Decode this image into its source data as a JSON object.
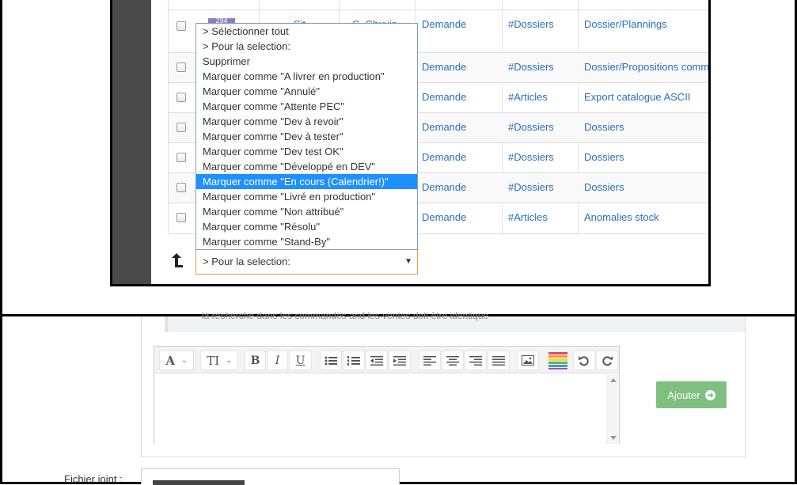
{
  "table": {
    "rows": [
      {
        "tag": "294",
        "col2": "...Sit...",
        "col3": "C. Chuvin",
        "type": "Demande",
        "category": "#Dossiers",
        "subject": "Dossier/Plannings"
      },
      {
        "type": "Demande",
        "category": "#Dossiers",
        "subject": "Dossier/Propositions comm"
      },
      {
        "type": "Demande",
        "category": "#Articles",
        "subject": "Export catalogue ASCII"
      },
      {
        "type": "Demande",
        "category": "#Dossiers",
        "subject": "Dossiers"
      },
      {
        "type": "Demande",
        "category": "#Dossiers",
        "subject": "Dossiers"
      },
      {
        "type": "Demande",
        "category": "#Dossiers",
        "subject": "Dossiers"
      },
      {
        "type": "Demande",
        "category": "#Articles",
        "subject": "Anomalies stock"
      }
    ]
  },
  "bulk_action": {
    "options": [
      "> Sélectionner tout",
      "> Pour la selection:",
      "Supprimer",
      "Marquer comme \"A livrer en production\"",
      "Marquer comme \"Annulé\"",
      "Marquer comme \"Attente PEC\"",
      "Marquer comme \"Dev à revoir\"",
      "Marquer comme \"Dev à tester\"",
      "Marquer comme \"Dev test OK\"",
      "Marquer comme \"Développé en DEV\"",
      "Marquer comme \"En cours (Calendrier!)\"",
      "Marquer comme \"Livré en production\"",
      "Marquer comme \"Non attribué\"",
      "Marquer comme \"Résolu\"",
      "Marquer comme \"Stand-By\""
    ],
    "highlighted_index": 10,
    "selected_value": "> Pour la selection:"
  },
  "comment": {
    "quote_text": "la recherche dans les commandes and les ventes doit être identique"
  },
  "editor": {
    "toolbar": {
      "font_label": "A",
      "size_label": "TI",
      "bold_label": "B",
      "italic_label": "I",
      "underline_label": "U"
    }
  },
  "add_button": {
    "label": "Ajouter"
  },
  "attachment": {
    "label": "Fichier joint :"
  },
  "colors": {
    "accent_blue": "#2a6ebb",
    "highlight": "#1e90ff",
    "add_green": "#7fbf7f",
    "tag_purple": "#8e7cc3"
  }
}
